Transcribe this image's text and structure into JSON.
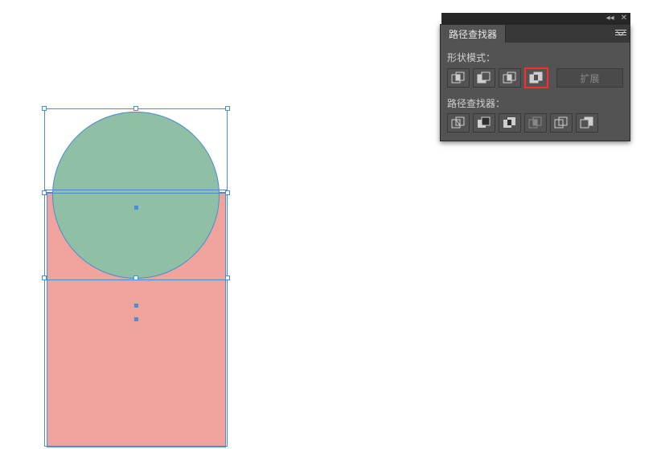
{
  "panel": {
    "title": "路径查找器",
    "section_shape_modes": "形状模式：",
    "section_pathfinders": "路径查找器：",
    "expand_label": "扩展",
    "shape_mode_icons": {
      "unite": "unite-icon",
      "minus_front": "minus-front-icon",
      "intersect": "intersect-icon",
      "exclude": "exclude-icon"
    },
    "pathfinder_icons": {
      "divide": "divide-icon",
      "trim": "trim-icon",
      "merge": "merge-icon",
      "crop": "crop-icon",
      "outline": "outline-icon",
      "minus_back": "minus-back-icon"
    },
    "highlighted": "exclude"
  },
  "artwork": {
    "circle_fill": "#8fbfa5",
    "rect_fill": "#f0a39c",
    "selection_stroke": "#4a8dd6"
  }
}
